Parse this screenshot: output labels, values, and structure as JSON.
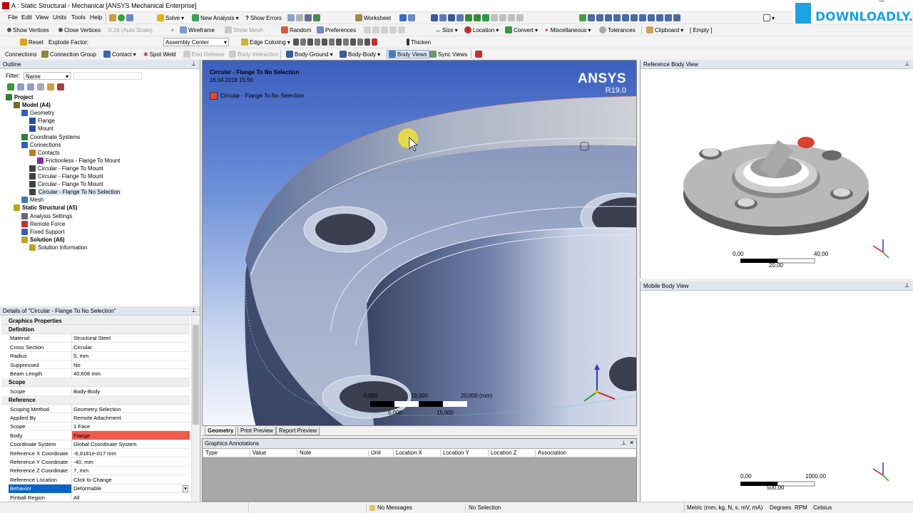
{
  "window": {
    "title": "A : Static Structural - Mechanical [ANSYS Mechanical Enterprise]",
    "controls": [
      "–",
      "❐",
      "✕"
    ]
  },
  "menu": [
    "File",
    "Edit",
    "View",
    "Units",
    "Tools",
    "Help"
  ],
  "toolbar1": {
    "solve": "Solve",
    "new_analysis": "New Analysis",
    "show_errors": "Show Errors",
    "worksheet": "Worksheet"
  },
  "toolbar2": {
    "show_vertices": "Show Vertices",
    "close_vertices": "Close Vertices",
    "auto_scale": "0,16 (Auto Scale)",
    "wireframe": "Wireframe",
    "show_mesh": "Show Mesh",
    "random": "Random",
    "preferences": "Preferences",
    "size": "Size",
    "location": "Location",
    "convert": "Convert",
    "miscellaneous": "Miscellaneous",
    "tolerances": "Tolerances",
    "clipboard": "Clipboard",
    "empty": "[ Empty ]"
  },
  "toolbar3": {
    "reset": "Reset",
    "explode_factor": "Explode Factor:",
    "assembly_center": "Assembly Center",
    "edge_coloring": "Edge Coloring",
    "thicken": "Thicken"
  },
  "toolbar4": {
    "connections": "Connections",
    "connection_group": "Connection Group",
    "contact": "Contact",
    "spot_weld": "Spot Weld",
    "end_release": "End Release",
    "body_interaction": "Body Interaction",
    "body_ground": "Body-Ground",
    "body_body": "Body-Body",
    "body_views": "Body Views",
    "sync_views": "Sync Views"
  },
  "watermark": "DOWNLOADLY.IR",
  "outline": {
    "title": "Outline",
    "filter_label": "Filter:",
    "filter_value": "Name",
    "tree": [
      {
        "label": "Project",
        "bold": true,
        "indent": 0,
        "color": "#3a7a3a"
      },
      {
        "label": "Model (A4)",
        "bold": true,
        "indent": 1,
        "color": "#7a6a2a"
      },
      {
        "label": "Geometry",
        "bold": false,
        "indent": 2,
        "color": "#3060c0"
      },
      {
        "label": "Flange",
        "bold": false,
        "indent": 3,
        "color": "#2a4fa0"
      },
      {
        "label": "Mount",
        "bold": false,
        "indent": 3,
        "color": "#2a4fa0"
      },
      {
        "label": "Coordinate Systems",
        "bold": false,
        "indent": 2,
        "color": "#3a7a3a"
      },
      {
        "label": "Connections",
        "bold": false,
        "indent": 2,
        "color": "#3060c0"
      },
      {
        "label": "Contacts",
        "bold": false,
        "indent": 3,
        "color": "#b08030"
      },
      {
        "label": "Frictionless - Flange To Mount",
        "bold": false,
        "indent": 4,
        "color": "#8030a0"
      },
      {
        "label": "Circular - Flange To Mount",
        "bold": false,
        "indent": 3,
        "color": "#404040"
      },
      {
        "label": "Circular - Flange To Mount",
        "bold": false,
        "indent": 3,
        "color": "#404040"
      },
      {
        "label": "Circular - Flange To Mount",
        "bold": false,
        "indent": 3,
        "color": "#404040"
      },
      {
        "label": "Circular - Flange To No Selection",
        "bold": false,
        "indent": 3,
        "color": "#404040",
        "selected": true
      },
      {
        "label": "Mesh",
        "bold": false,
        "indent": 2,
        "color": "#3a7ab0"
      },
      {
        "label": "Static Structural (A5)",
        "bold": true,
        "indent": 1,
        "color": "#c0a020"
      },
      {
        "label": "Analysis Settings",
        "bold": false,
        "indent": 2,
        "color": "#6a6a6a"
      },
      {
        "label": "Remote Force",
        "bold": false,
        "indent": 2,
        "color": "#c03030"
      },
      {
        "label": "Fixed Support",
        "bold": false,
        "indent": 2,
        "color": "#3060c0"
      },
      {
        "label": "Solution (A6)",
        "bold": true,
        "indent": 2,
        "color": "#c0a020"
      },
      {
        "label": "Solution Information",
        "bold": false,
        "indent": 3,
        "color": "#c0a020"
      }
    ]
  },
  "details": {
    "title": "Details of \"Circular - Flange To No Selection\"",
    "rows": [
      {
        "type": "section",
        "label": "Graphics Properties"
      },
      {
        "type": "section",
        "label": "Definition"
      },
      {
        "type": "row",
        "key": "Material",
        "value": "Structural Steel"
      },
      {
        "type": "row",
        "key": "Cross Section",
        "value": "Circular"
      },
      {
        "type": "row",
        "key": "Radius",
        "value": "5, mm"
      },
      {
        "type": "row",
        "key": "Suppressed",
        "value": "No"
      },
      {
        "type": "row",
        "key": "Beam Length",
        "value": "40,608 mm"
      },
      {
        "type": "section",
        "label": "Scope"
      },
      {
        "type": "row",
        "key": "Scope",
        "value": "Body-Body"
      },
      {
        "type": "section",
        "label": "Reference"
      },
      {
        "type": "row",
        "key": "Scoping Method",
        "value": "Geometry Selection"
      },
      {
        "type": "row",
        "key": "Applied By",
        "value": "Remote Attachment"
      },
      {
        "type": "row",
        "key": "Scope",
        "value": "1 Face"
      },
      {
        "type": "row",
        "key": "Body",
        "value": "Flange",
        "highlight": "#f05b4f"
      },
      {
        "type": "row",
        "key": "Coordinate System",
        "value": "Global Coordinate System"
      },
      {
        "type": "row",
        "key": "Reference X Coordinate",
        "value": "-6,8181e-017 mm"
      },
      {
        "type": "row",
        "key": "Reference Y Coordinate",
        "value": "-40, mm"
      },
      {
        "type": "row",
        "key": "Reference Z Coordinate",
        "value": "7, mm"
      },
      {
        "type": "row",
        "key": "Reference Location",
        "value": "Click to Change"
      },
      {
        "type": "row",
        "key": "Behavior",
        "value": "Deformable",
        "keyHighlight": "#0a64c8",
        "dropdown": true
      },
      {
        "type": "row",
        "key": "Pinball Region",
        "value": "All"
      }
    ]
  },
  "viewport": {
    "object_title": "Circular - Flange To No Selection",
    "date": "16.04.2018 15:56",
    "legend_label": "Circular - Flange To No Selection",
    "legend_color": "#e8463c",
    "brand": "ANSYS",
    "version": "R19.0",
    "scale_top": [
      "0,000",
      "10,000",
      "20,000 (mm)"
    ],
    "scale_bottom": [
      "5,000",
      "15,000"
    ],
    "tabs": [
      "Geometry",
      "Print Preview",
      "Report Preview"
    ]
  },
  "annotations": {
    "title": "Graphics Annotations",
    "columns": [
      "Type",
      "Value",
      "Note",
      "Unit",
      "Location X",
      "Location Y",
      "Location Z",
      "Association"
    ]
  },
  "reference_view": {
    "title": "Reference Body View",
    "scale_left": "0,00",
    "scale_right": "40,00",
    "scale_mid": "20,00"
  },
  "mobile_view": {
    "title": "Mobile Body View",
    "scale_left": "0,00",
    "scale_right": "1000,00",
    "scale_mid": "500,00"
  },
  "status": {
    "messages": "No Messages",
    "selection": "No Selection",
    "units": "Metric (mm, kg, N, s, mV, mA)",
    "angle": "Degrees",
    "rpm": "RPM",
    "temperature": "Celsius"
  }
}
